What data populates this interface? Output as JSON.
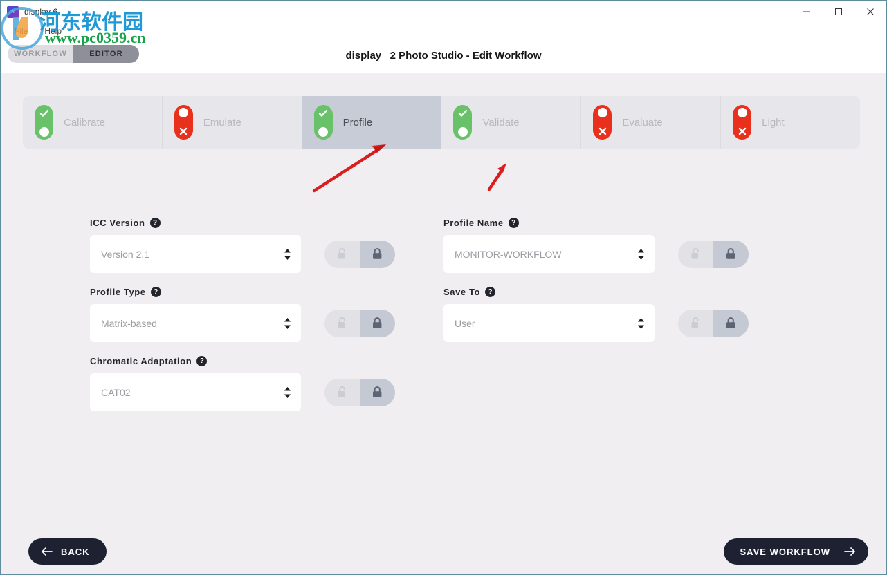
{
  "window": {
    "title": "display 6",
    "controls": {
      "minimize": "minimize",
      "maximize": "maximize",
      "close": "close"
    }
  },
  "menubar": {
    "items": [
      {
        "label": "File"
      },
      {
        "label": "Help"
      }
    ]
  },
  "header": {
    "mode_toggle": {
      "options": [
        {
          "label": "WORKFLOW",
          "active": false
        },
        {
          "label": "EDITOR",
          "active": true
        }
      ]
    },
    "title_brand": "display",
    "title_rest": "2 Photo Studio - Edit Workflow"
  },
  "steps": [
    {
      "label": "Calibrate",
      "state": "on",
      "active": false
    },
    {
      "label": "Emulate",
      "state": "off",
      "active": false
    },
    {
      "label": "Profile",
      "state": "on",
      "active": true
    },
    {
      "label": "Validate",
      "state": "on",
      "active": false
    },
    {
      "label": "Evaluate",
      "state": "off",
      "active": false
    },
    {
      "label": "Light",
      "state": "off",
      "active": false
    }
  ],
  "form": {
    "left": [
      {
        "label": "ICC Version",
        "help": "?",
        "value": "Version 2.1",
        "lock": {
          "unlocked_label": "unlocked",
          "locked_label": "locked",
          "state": "locked"
        }
      },
      {
        "label": "Profile Type",
        "help": "?",
        "value": "Matrix-based",
        "lock": {
          "unlocked_label": "unlocked",
          "locked_label": "locked",
          "state": "locked"
        }
      },
      {
        "label": "Chromatic Adaptation",
        "help": "?",
        "value": "CAT02",
        "lock": {
          "unlocked_label": "unlocked",
          "locked_label": "locked",
          "state": "locked"
        }
      }
    ],
    "right": [
      {
        "label": "Profile Name",
        "help": "?",
        "value": "MONITOR-WORKFLOW",
        "lock": {
          "unlocked_label": "unlocked",
          "locked_label": "locked",
          "state": "locked"
        }
      },
      {
        "label": "Save To",
        "help": "?",
        "value": "User",
        "lock": {
          "unlocked_label": "unlocked",
          "locked_label": "locked",
          "state": "locked"
        }
      }
    ]
  },
  "footer": {
    "back_label": "BACK",
    "save_label": "SAVE WORKFLOW"
  },
  "watermark": {
    "site_name": "河东软件园",
    "url": "www.pc0359.cn"
  },
  "colors": {
    "background": "#f0eef1",
    "panel": "#ffffff",
    "step_bar": "#e7e6ea",
    "step_active": "#c8ccd6",
    "state_on": "#69c169",
    "state_off": "#e8301c",
    "button_dark": "#1d2132",
    "annotation_arrow": "#d81f1f",
    "lock_selected": "#c5c9d3"
  }
}
